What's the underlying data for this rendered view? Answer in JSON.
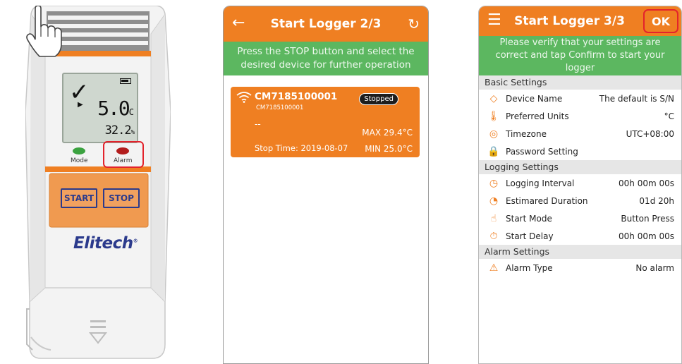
{
  "device": {
    "lcd": {
      "temperature": "5.0",
      "temp_unit": "C",
      "humidity": "32.2",
      "hum_unit": "%"
    },
    "mode_label": "Mode",
    "alarm_label": "Alarm",
    "start_label": "START",
    "stop_label": "STOP",
    "brand": "Elitech",
    "colors": {
      "body": "#f4f4f4",
      "accent": "#ef7f22",
      "brand": "#2b3a8c"
    }
  },
  "screen2": {
    "title": "Start Logger 2/3",
    "back_icon": "back-arrow-icon",
    "refresh_icon": "refresh-icon",
    "instruction": "Press the STOP button and select the desired device for further operation",
    "card": {
      "name": "CM7185100001",
      "serial": "CM7185100001",
      "status": "Stopped",
      "placeholder": "--",
      "max": "MAX  29.4°C",
      "stop_time": "Stop Time: 2019-08-07",
      "min": "MIN  25.0°C"
    }
  },
  "screen3": {
    "title": "Start Logger 3/3",
    "ok_label": "OK",
    "instruction": "Please verify that your settings are correct and tap Confirm to start your logger",
    "sections": [
      {
        "title": "Basic Settings",
        "rows": [
          {
            "icon": "tag-icon",
            "label": "Device Name",
            "value": "The default is S/N"
          },
          {
            "icon": "thermometer-icon",
            "label": "Preferred Units",
            "value": "°C"
          },
          {
            "icon": "globe-icon",
            "label": "Timezone",
            "value": "UTC+08:00"
          },
          {
            "icon": "lock-icon",
            "label": "Password Setting",
            "value": ""
          }
        ]
      },
      {
        "title": "Logging  Settings",
        "rows": [
          {
            "icon": "timer-icon",
            "label": "Logging  Interval",
            "value": "00h 00m 00s"
          },
          {
            "icon": "clock-icon",
            "label": "Estimared Duration",
            "value": "01d 20h"
          },
          {
            "icon": "hand-pointer-icon",
            "label": "Start Mode",
            "value": "Button Press"
          },
          {
            "icon": "stopwatch-icon",
            "label": "Start Delay",
            "value": "00h 00m 00s"
          }
        ]
      },
      {
        "title": "Alarm Settings",
        "rows": [
          {
            "icon": "alarm-light-icon",
            "label": "Alarm  Type",
            "value": "No alarm"
          }
        ]
      }
    ]
  }
}
